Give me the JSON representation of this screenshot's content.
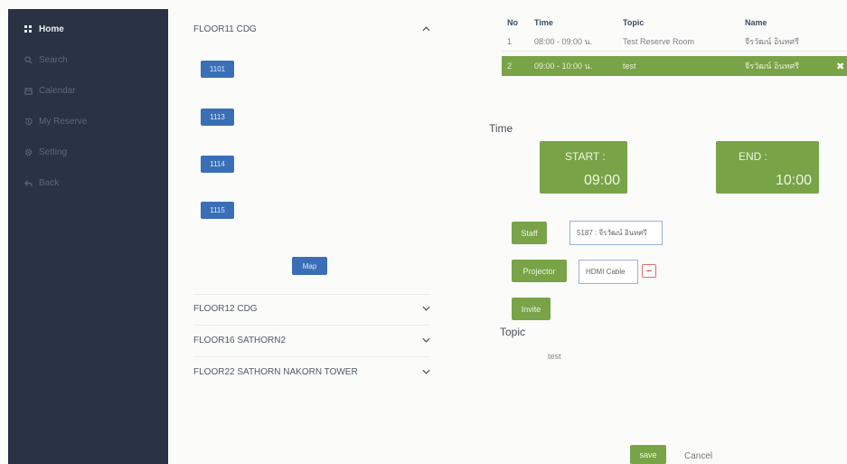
{
  "sidebar": {
    "items": [
      {
        "label": "Home",
        "icon": "grid-icon",
        "active": true
      },
      {
        "label": "Search",
        "icon": "search-icon"
      },
      {
        "label": "Calendar",
        "icon": "calendar-icon"
      },
      {
        "label": "My Reserve",
        "icon": "history-icon"
      },
      {
        "label": "Setting",
        "icon": "gear-icon"
      },
      {
        "label": "Back",
        "icon": "reply-icon"
      }
    ]
  },
  "floors": [
    {
      "name": "FLOOR11 CDG",
      "expanded": true,
      "rooms": [
        "1101",
        "1113",
        "1114",
        "1115"
      ],
      "map_label": "Map"
    },
    {
      "name": "FLOOR12 CDG",
      "expanded": false
    },
    {
      "name": "FLOOR16 SATHORN2",
      "expanded": false
    },
    {
      "name": "FLOOR22 SATHORN NAKORN TOWER",
      "expanded": false
    }
  ],
  "reservations": {
    "columns": [
      "No",
      "Time",
      "Topic",
      "Name"
    ],
    "rows": [
      {
        "no": "1",
        "time": "08:00 - 09:00 น.",
        "topic": "Test Reserve Room",
        "name": "จีรวัฒน์ อินทศรี"
      },
      {
        "no": "2",
        "time": "09:00 - 10:00 น.",
        "topic": "test",
        "name": "จีรวัฒน์ อินทศรี",
        "selected": true
      }
    ]
  },
  "form": {
    "time_label": "Time",
    "start_label": "START :",
    "start_value": "09:00",
    "end_label": "END :",
    "end_value": "10:00",
    "staff_label": "Staff",
    "staff_value": "5187 : จีรวัฒน์ อินทศรี",
    "projector_label": "Projector",
    "projector_value": "HDMI Cable",
    "invite_label": "Invite",
    "topic_label": "Topic",
    "topic_value": "test",
    "save_label": "save",
    "cancel_label": "Cancel"
  },
  "colors": {
    "sidebar_bg": "#2a3344",
    "accent_green": "#78a347",
    "room_blue": "#3a6fb8",
    "remove_red": "#e24a4a"
  }
}
